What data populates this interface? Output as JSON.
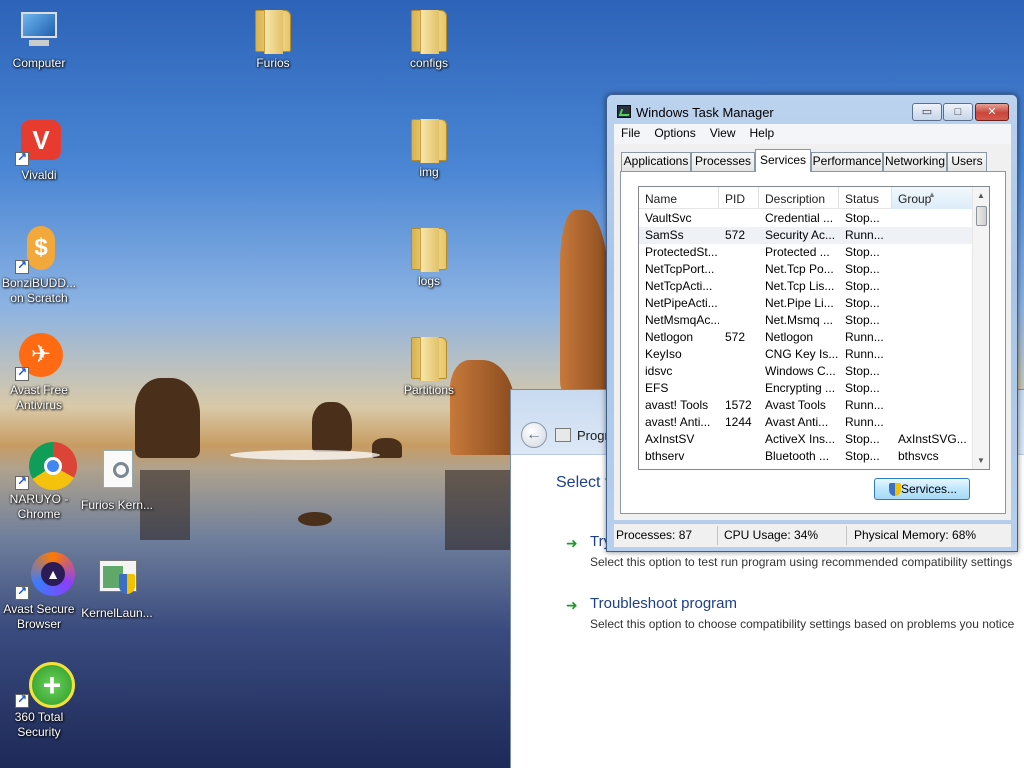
{
  "desktop": {
    "icons": [
      {
        "label": "Computer",
        "icon": "computer-icon"
      },
      {
        "label": "Vivaldi",
        "icon": "vivaldi-icon"
      },
      {
        "label": "BonziBUDD... on Scratch",
        "icon": "bonzibuddy-icon"
      },
      {
        "label": "Avast Free Antivirus",
        "icon": "avast-icon"
      },
      {
        "label": "NARUYO - Chrome",
        "icon": "chrome-icon"
      },
      {
        "label": "Furios Kern...",
        "icon": "furios-kernel-icon"
      },
      {
        "label": "Avast Secure Browser",
        "icon": "avast-secure-browser-icon"
      },
      {
        "label": "KernelLaun...",
        "icon": "kernel-launcher-icon"
      },
      {
        "label": "360 Total Security",
        "icon": "360-total-security-icon"
      },
      {
        "label": "Furios",
        "icon": "folder-icon"
      },
      {
        "label": "configs",
        "icon": "folder-icon"
      },
      {
        "label": "img",
        "icon": "folder-icon"
      },
      {
        "label": "logs",
        "icon": "folder-icon"
      },
      {
        "label": "Partitions",
        "icon": "folder-icon"
      }
    ]
  },
  "compat_window": {
    "title": "Progr",
    "heading": "Select t",
    "options": [
      {
        "title": "Try",
        "description": "Select this option to test run program using recommended compatibility settings"
      },
      {
        "title": "Troubleshoot program",
        "description": "Select this option to choose compatibility settings based on problems you notice"
      }
    ]
  },
  "task_manager": {
    "title": "Windows Task Manager",
    "controls": {
      "minimize": "▭",
      "maximize": "□",
      "close": "✕"
    },
    "menu": [
      "File",
      "Options",
      "View",
      "Help"
    ],
    "tabs": [
      "Applications",
      "Processes",
      "Services",
      "Performance",
      "Networking",
      "Users"
    ],
    "active_tab": "Services",
    "columns": [
      "Name",
      "PID",
      "Description",
      "Status",
      "Group"
    ],
    "sorted_column": "Group",
    "rows": [
      [
        "VaultSvc",
        "",
        "Credential ...",
        "Stop...",
        ""
      ],
      [
        "SamSs",
        "572",
        "Security Ac...",
        "Runn...",
        ""
      ],
      [
        "ProtectedSt...",
        "",
        "Protected ...",
        "Stop...",
        ""
      ],
      [
        "NetTcpPort...",
        "",
        "Net.Tcp Po...",
        "Stop...",
        ""
      ],
      [
        "NetTcpActi...",
        "",
        "Net.Tcp Lis...",
        "Stop...",
        ""
      ],
      [
        "NetPipeActi...",
        "",
        "Net.Pipe Li...",
        "Stop...",
        ""
      ],
      [
        "NetMsmqAc...",
        "",
        "Net.Msmq ...",
        "Stop...",
        ""
      ],
      [
        "Netlogon",
        "572",
        "Netlogon",
        "Runn...",
        ""
      ],
      [
        "KeyIso",
        "",
        "CNG Key Is...",
        "Runn...",
        ""
      ],
      [
        "idsvc",
        "",
        "Windows C...",
        "Stop...",
        ""
      ],
      [
        "EFS",
        "",
        "Encrypting ...",
        "Stop...",
        ""
      ],
      [
        "avast! Tools",
        "1572",
        "Avast Tools",
        "Runn...",
        ""
      ],
      [
        "avast! Anti...",
        "1244",
        "Avast Anti...",
        "Runn...",
        ""
      ],
      [
        "AxInstSV",
        "",
        "ActiveX Ins...",
        "Stop...",
        "AxInstSVG..."
      ],
      [
        "bthserv",
        "",
        "Bluetooth ...",
        "Stop...",
        "bthsvcs"
      ]
    ],
    "selected_row": 1,
    "services_button": "Services...",
    "status": {
      "processes": "Processes: 87",
      "cpu": "CPU Usage: 34%",
      "memory": "Physical Memory: 68%"
    }
  }
}
